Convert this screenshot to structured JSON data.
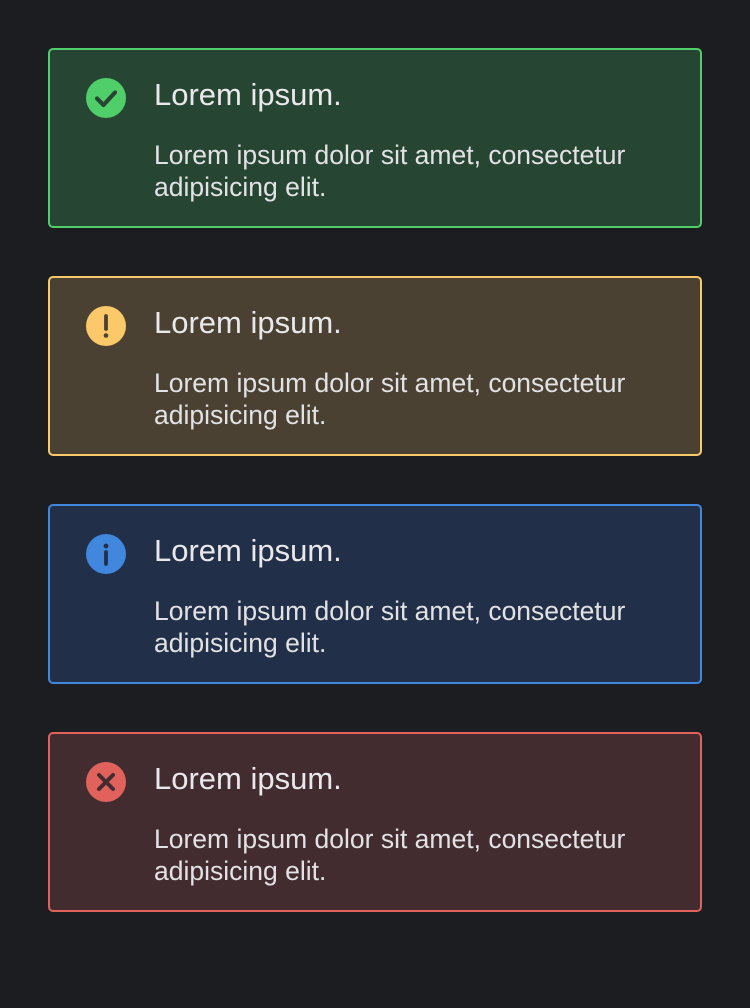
{
  "colors": {
    "background": "#1c1d21",
    "success": "#4fce6a",
    "warning": "#fbc96a",
    "info": "#4187de",
    "error": "#e1625d",
    "text": "#e9e9eb"
  },
  "alerts": [
    {
      "type": "success",
      "icon": "check-circle-icon",
      "title": "Lorem ipsum.",
      "body": "Lorem ipsum dolor sit amet, consectetur adipisicing elit."
    },
    {
      "type": "warning",
      "icon": "exclamation-circle-icon",
      "title": "Lorem ipsum.",
      "body": "Lorem ipsum dolor sit amet, consectetur adipisicing elit."
    },
    {
      "type": "info",
      "icon": "info-circle-icon",
      "title": "Lorem ipsum.",
      "body": "Lorem ipsum dolor sit amet, consectetur adipisicing elit."
    },
    {
      "type": "error",
      "icon": "x-circle-icon",
      "title": "Lorem ipsum.",
      "body": "Lorem ipsum dolor sit amet, consectetur adipisicing elit."
    }
  ]
}
